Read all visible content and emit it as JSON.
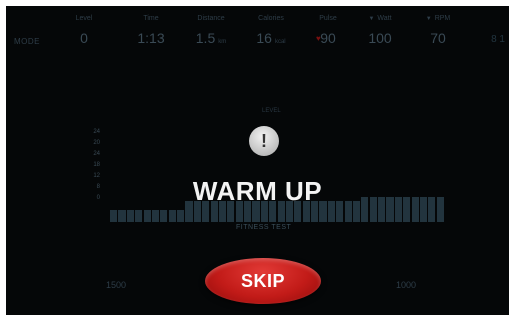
{
  "header": {
    "mode": "MODE",
    "stats": [
      {
        "label": "Level",
        "value": "0",
        "unit": ""
      },
      {
        "label": "Time",
        "value": "1:13",
        "unit": ""
      },
      {
        "label": "Distance",
        "value": "1.5",
        "unit": "km"
      },
      {
        "label": "Calories",
        "value": "16",
        "unit": "kcal"
      },
      {
        "label": "Pulse",
        "value": "90",
        "unit": ""
      },
      {
        "label": "Watt",
        "value": "100",
        "unit": ""
      },
      {
        "label": "RPM",
        "value": "70",
        "unit": ""
      }
    ],
    "edge_marks": "8 1",
    "heart_color": "#7a1010"
  },
  "chart": {
    "title": "LEVEL",
    "xlabel": "FITNESS TEST"
  },
  "chart_data": {
    "type": "bar",
    "title": "LEVEL",
    "xlabel": "FITNESS TEST",
    "ylabel": "",
    "y_ticks": [
      "24",
      "20",
      "24",
      "18",
      "12",
      "8",
      "0"
    ],
    "ylim": [
      0,
      24
    ],
    "values": [
      3,
      3,
      3,
      3,
      3,
      3,
      3,
      3,
      3,
      5,
      5,
      5,
      5,
      5,
      5,
      5,
      5,
      5,
      5,
      5,
      5,
      5,
      5,
      5,
      5,
      5,
      5,
      5,
      5,
      5,
      6,
      6,
      6,
      6,
      6,
      6,
      6,
      6,
      6,
      6
    ],
    "bar_color": "#22343e"
  },
  "alert": {
    "icon": "exclamation-icon",
    "icon_glyph": "!",
    "title": "WARM UP"
  },
  "bottom": {
    "left_text": "1500",
    "right_text": "1000",
    "skip_label": "SKIP",
    "skip_color": "#c21b18"
  }
}
